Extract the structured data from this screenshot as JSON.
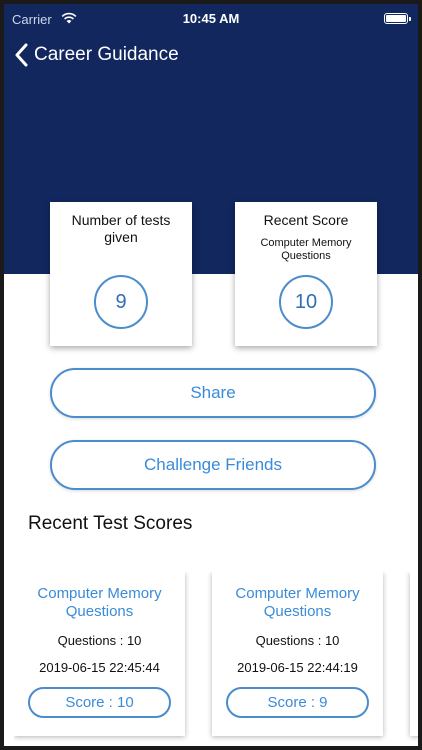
{
  "status_bar": {
    "carrier": "Carrier",
    "time": "10:45 AM"
  },
  "nav": {
    "title": "Career Guidance"
  },
  "stats": {
    "tests_given": {
      "label": "Number of tests given",
      "value": "9"
    },
    "recent_score": {
      "label": "Recent Score",
      "subtitle": "Computer Memory Questions",
      "value": "10"
    }
  },
  "actions": {
    "share_label": "Share",
    "challenge_label": "Challenge Friends"
  },
  "recent": {
    "title": "Recent Test Scores",
    "cards": [
      {
        "title": "Computer Memory Questions",
        "questions": "Questions : 10",
        "date": "2019-06-15 22:45:44",
        "score": "Score : 10"
      },
      {
        "title": "Computer Memory Questions",
        "questions": "Questions : 10",
        "date": "2019-06-15 22:44:19",
        "score": "Score : 9"
      }
    ]
  },
  "colors": {
    "header_bg": "#13275f",
    "accent": "#3a8bd8",
    "border": "#4a8ccc"
  },
  "icons": {
    "back": "chevron-left-icon",
    "wifi": "wifi-icon",
    "battery": "battery-icon"
  }
}
